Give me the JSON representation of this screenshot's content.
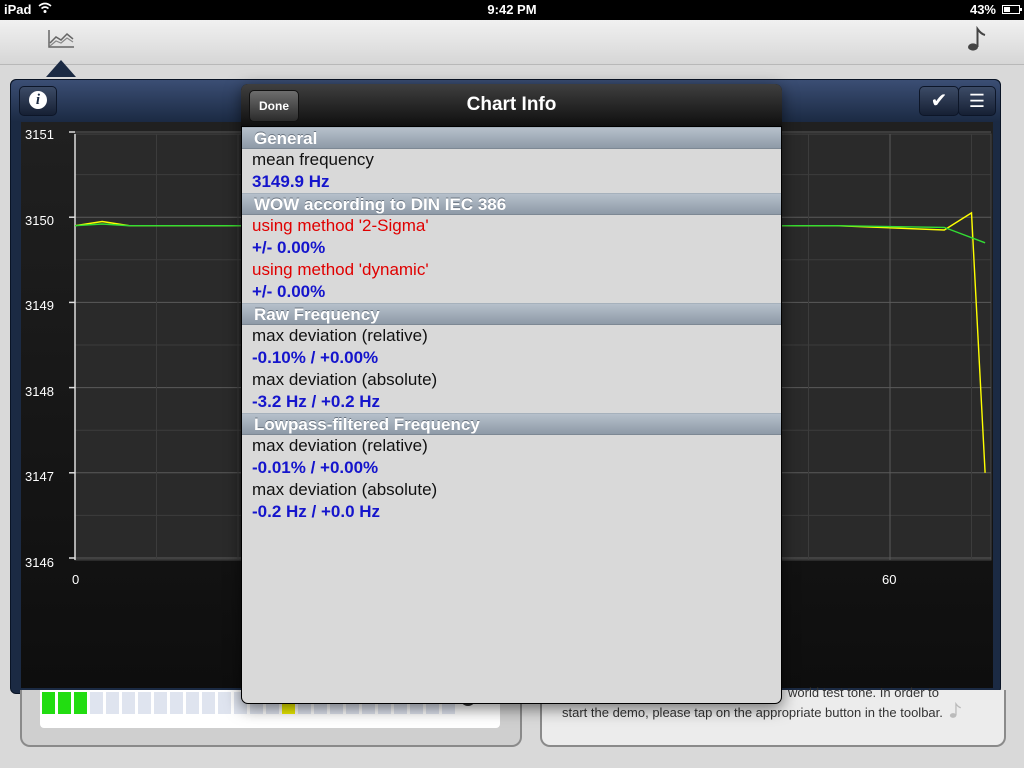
{
  "status_bar": {
    "device": "iPad",
    "time": "9:42 PM",
    "battery": "43%"
  },
  "toolbar": {
    "chart_icon": "line-chart-icon",
    "music_icon": "music-note-icon"
  },
  "chart": {
    "info_icon": "info-icon",
    "check_icon": "checkmark-icon",
    "list_icon": "list-icon",
    "y_ticks": [
      "3151",
      "3150",
      "3149",
      "3148",
      "3147",
      "3146"
    ],
    "x_ticks": [
      "0",
      "60"
    ]
  },
  "chart_data": {
    "type": "line",
    "ylim": [
      3146,
      3151
    ],
    "x_ticks": [
      0,
      60
    ],
    "y_ticks": [
      3146,
      3147,
      3148,
      3149,
      3150,
      3151
    ],
    "grid": true,
    "series": [
      {
        "color": "#ffff00",
        "points": [
          [
            0,
            3149.9
          ],
          [
            2,
            3149.95
          ],
          [
            4,
            3149.9
          ],
          [
            50,
            3149.9
          ],
          [
            56,
            3149.9
          ],
          [
            64,
            3149.85
          ],
          [
            66,
            3150.05
          ],
          [
            67,
            3147.0
          ]
        ]
      },
      {
        "color": "#33dd33",
        "points": [
          [
            0,
            3149.9
          ],
          [
            2,
            3149.92
          ],
          [
            4,
            3149.9
          ],
          [
            50,
            3149.9
          ],
          [
            56,
            3149.9
          ],
          [
            64,
            3149.88
          ],
          [
            67,
            3149.7
          ]
        ]
      }
    ]
  },
  "popover": {
    "done_label": "Done",
    "title": "Chart Info",
    "sections": [
      {
        "header": "General",
        "rows": [
          {
            "label": "mean frequency",
            "value": "3149.9 Hz"
          }
        ]
      },
      {
        "header": "WOW according to DIN IEC 386",
        "rows": [
          {
            "label": "using method '2-Sigma'",
            "value": "+/- 0.00%",
            "red": true
          },
          {
            "label": "using method 'dynamic'",
            "value": "+/- 0.00%",
            "red": true
          }
        ]
      },
      {
        "header": "Raw Frequency",
        "rows": [
          {
            "label": "max deviation (relative)",
            "value": "-0.10% / +0.00%"
          },
          {
            "label": "max deviation (absolute)",
            "value": "-3.2 Hz / +0.2 Hz"
          }
        ]
      },
      {
        "header": "Lowpass-filtered Frequency",
        "rows": [
          {
            "label": "max deviation (relative)",
            "value": "-0.01% / +0.00%"
          },
          {
            "label": "max deviation (absolute)",
            "value": "-0.2 Hz / +0.0 Hz"
          }
        ]
      }
    ]
  },
  "bottom": {
    "level_meter": {
      "level": 0.1,
      "colors": {
        "active": "#22dd11",
        "peak": "#eeee00",
        "inactive": "#dfe4ef"
      }
    },
    "description_line1": "world test tone. In order to",
    "description_line2": "start the demo, please tap on the appropriate button in the toolbar.",
    "note_icon": "music-note-icon"
  }
}
